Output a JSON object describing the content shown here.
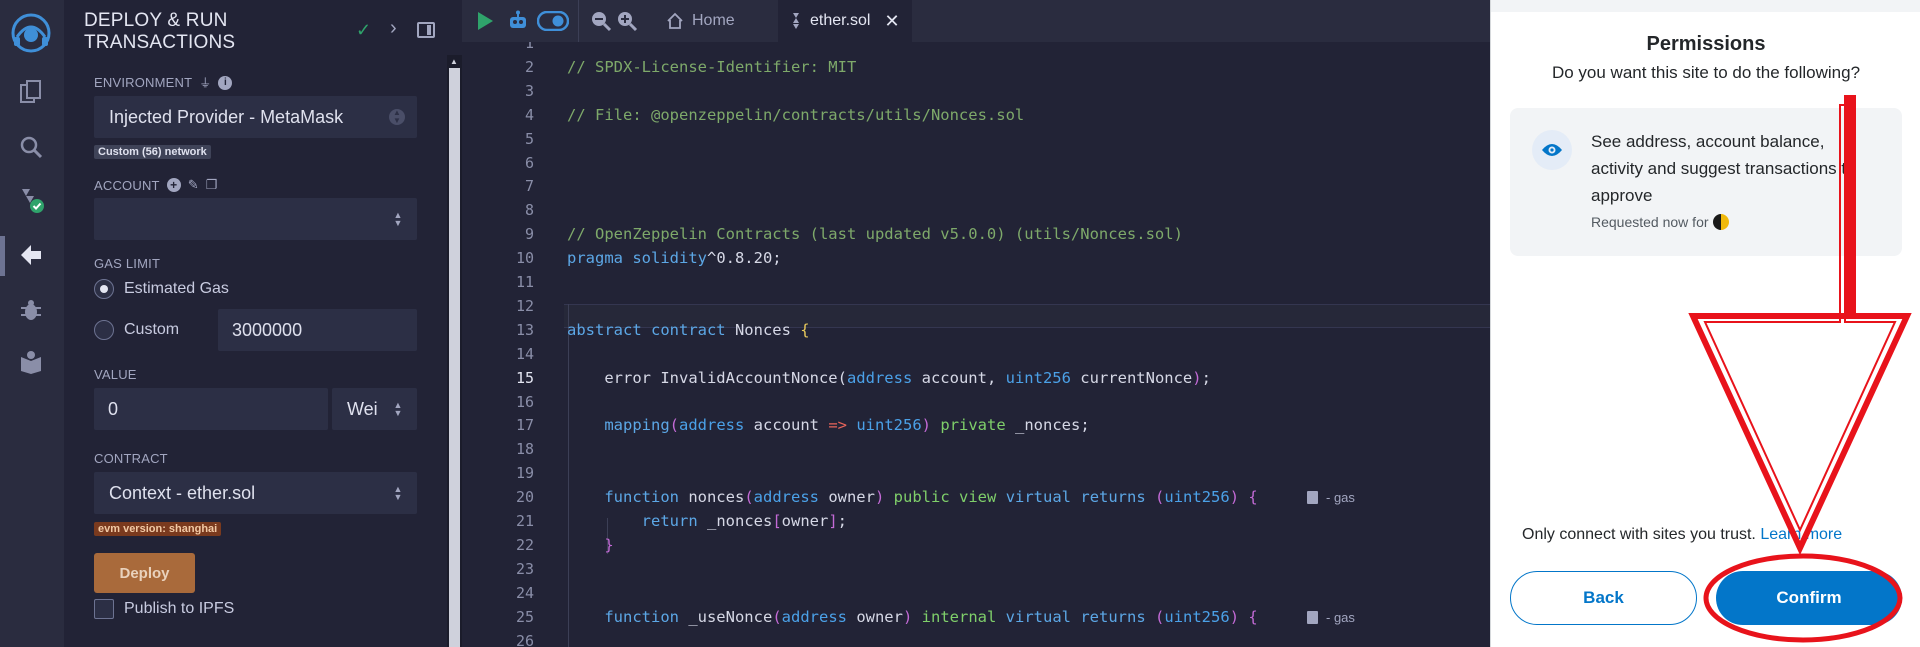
{
  "app": {
    "panel_title": "DEPLOY & RUN TRANSACTIONS",
    "rail_icons": [
      "remix-logo-icon",
      "file-explorer-icon",
      "search-icon",
      "solidity-compiler-icon",
      "deploy-run-icon",
      "debugger-icon",
      "learneth-icon"
    ]
  },
  "panel": {
    "environment_label": "ENVIRONMENT",
    "environment_value": "Injected Provider - MetaMask",
    "network_badge": "Custom (56) network",
    "account_label": "ACCOUNT",
    "account_value": "",
    "gas_limit_label": "GAS LIMIT",
    "gas_estimated_label": "Estimated Gas",
    "gas_custom_label": "Custom",
    "gas_custom_value": "3000000",
    "value_label": "VALUE",
    "value_amount": "0",
    "value_unit": "Wei",
    "contract_label": "CONTRACT",
    "contract_value": "Context - ether.sol",
    "evm_badge": "evm version: shanghai",
    "deploy_button": "Deploy",
    "publish_label": "Publish to IPFS"
  },
  "editor": {
    "tabs": [
      {
        "label": "Home",
        "active": false
      },
      {
        "label": "ether.sol",
        "active": true
      }
    ],
    "current_line": 15,
    "gas_label": "- gas"
  },
  "metamask": {
    "heading": "Permissions",
    "subheading": "Do you want this site to do the following?",
    "permission_text": "See address, account balance, activity and suggest transactions to approve",
    "requested": "Requested now for",
    "trust_text": "Only connect with sites you trust.",
    "learn_more": "Learn more",
    "back_button": "Back",
    "confirm_button": "Confirm"
  },
  "colors": {
    "panel_bg": "#222336",
    "accent_blue": "#0376c9",
    "deploy_orange": "#a96a3b",
    "annotation_red": "#e8131b"
  }
}
